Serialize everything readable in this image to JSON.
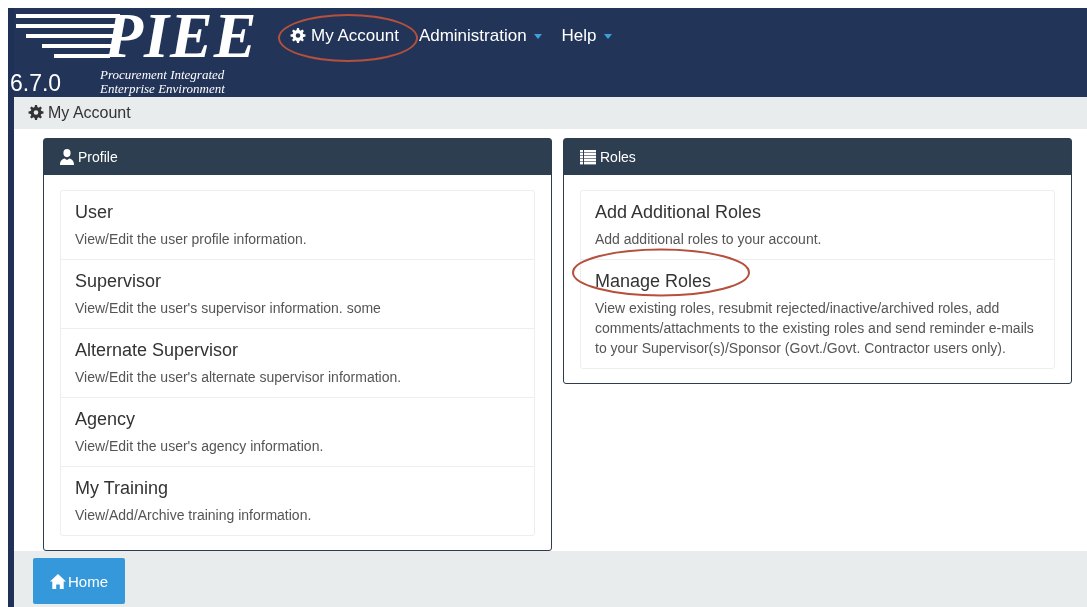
{
  "header": {
    "logo_text": "PIEE",
    "logo_subtitle": [
      "Procurement Integrated",
      "Enterprise Environment"
    ],
    "version": "6.7.0",
    "nav": [
      {
        "label": "My Account",
        "dropdown": false,
        "circled": true
      },
      {
        "label": "Administration",
        "dropdown": true,
        "circled": false
      },
      {
        "label": "Help",
        "dropdown": true,
        "circled": false
      }
    ]
  },
  "breadcrumb": "My Account",
  "panels": [
    {
      "title": "Profile",
      "items": [
        {
          "title": "User",
          "description": "View/Edit the user profile information.",
          "circled": false
        },
        {
          "title": "Supervisor",
          "description": "View/Edit the user's supervisor information. some",
          "circled": false
        },
        {
          "title": "Alternate Supervisor",
          "description": "View/Edit the user's alternate supervisor information.",
          "circled": false
        },
        {
          "title": "Agency",
          "description": "View/Edit the user's agency information.",
          "circled": false
        },
        {
          "title": "My Training",
          "description": "View/Add/Archive training information.",
          "circled": false
        }
      ]
    },
    {
      "title": "Roles",
      "items": [
        {
          "title": "Add Additional Roles",
          "description": "Add additional roles to your account.",
          "circled": false
        },
        {
          "title": "Manage Roles",
          "description": "View existing roles, resubmit rejected/inactive/archived roles, add comments/attachments to the existing roles and send reminder e-mails to your Supervisor(s)/Sponsor (Govt./Govt. Contractor users only).",
          "circled": true
        }
      ]
    }
  ],
  "home_button": "Home"
}
